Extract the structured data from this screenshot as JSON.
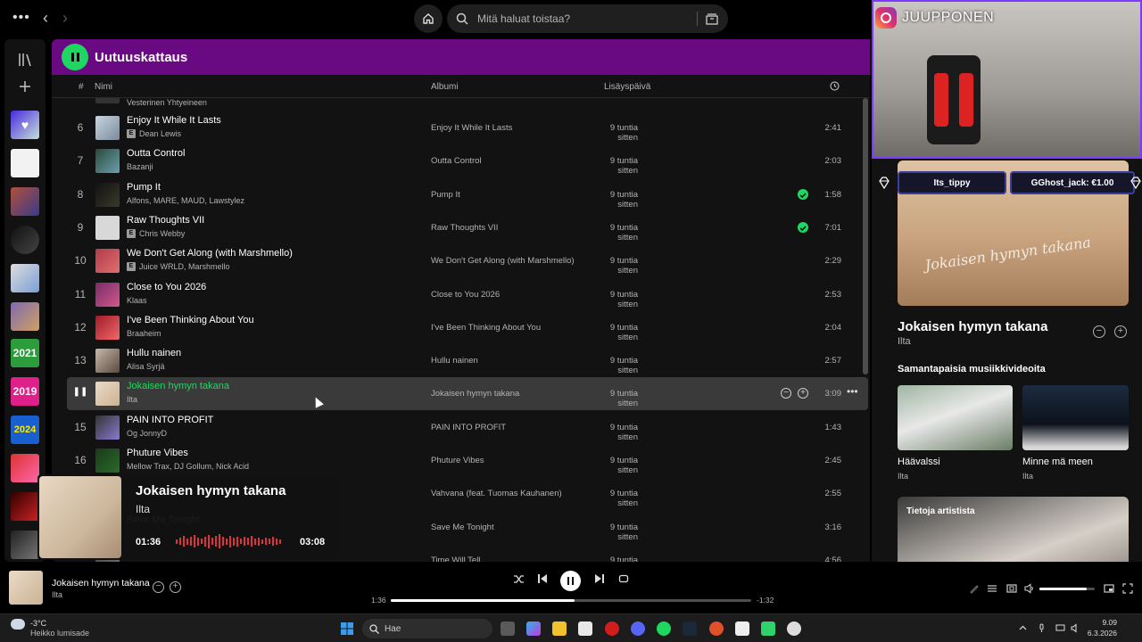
{
  "topbar": {
    "search_placeholder": "Mitä haluat toistaa?"
  },
  "playlist": {
    "title": "Uutuuskattaus",
    "columns": {
      "num": "#",
      "name": "Nimi",
      "album": "Albumi",
      "added": "Lisäyspäivä"
    },
    "partial_top_artist": "Vesterinen Yhtyeineen",
    "rows": [
      {
        "num": "6",
        "title": "Enjoy It While It Lasts",
        "artist": "Dean Lewis",
        "explicit": true,
        "album": "Enjoy It While It Lasts",
        "added": "9 tuntia sitten",
        "duration": "2:41",
        "liked": false,
        "active": false
      },
      {
        "num": "7",
        "title": "Outta Control",
        "artist": "Bazanji",
        "explicit": false,
        "album": "Outta Control",
        "added": "9 tuntia sitten",
        "duration": "2:03",
        "liked": false,
        "active": false
      },
      {
        "num": "8",
        "title": "Pump It",
        "artist": "Alfons, MARE, MAUD, Lawstylez",
        "explicit": false,
        "album": "Pump It",
        "added": "9 tuntia sitten",
        "duration": "1:58",
        "liked": true,
        "active": false
      },
      {
        "num": "9",
        "title": "Raw Thoughts VII",
        "artist": "Chris Webby",
        "explicit": true,
        "album": "Raw Thoughts VII",
        "added": "9 tuntia sitten",
        "duration": "7:01",
        "liked": true,
        "active": false
      },
      {
        "num": "10",
        "title": "We Don't Get Along (with Marshmello)",
        "artist": "Juice WRLD, Marshmello",
        "explicit": true,
        "album": "We Don't Get Along (with Marshmello)",
        "added": "9 tuntia sitten",
        "duration": "2:29",
        "liked": false,
        "active": false
      },
      {
        "num": "11",
        "title": "Close to You 2026",
        "artist": "Klaas",
        "explicit": false,
        "album": "Close to You 2026",
        "added": "9 tuntia sitten",
        "duration": "2:53",
        "liked": false,
        "active": false
      },
      {
        "num": "12",
        "title": "I've Been Thinking About You",
        "artist": "Braaheim",
        "explicit": false,
        "album": "I've Been Thinking About You",
        "added": "9 tuntia sitten",
        "duration": "2:04",
        "liked": false,
        "active": false
      },
      {
        "num": "13",
        "title": "Hullu nainen",
        "artist": "Alisa Syrjä",
        "explicit": false,
        "album": "Hullu nainen",
        "added": "9 tuntia sitten",
        "duration": "2:57",
        "liked": false,
        "active": false
      },
      {
        "num": "",
        "title": "Jokaisen hymyn takana",
        "artist": "Ilta",
        "explicit": false,
        "album": "Jokaisen hymyn takana",
        "added": "9 tuntia sitten",
        "duration": "3:09",
        "liked": false,
        "active": true
      },
      {
        "num": "15",
        "title": "PAIN INTO PROFIT",
        "artist": "Og JonnyD",
        "explicit": false,
        "album": "PAIN INTO PROFIT",
        "added": "9 tuntia sitten",
        "duration": "1:43",
        "liked": false,
        "active": false
      },
      {
        "num": "16",
        "title": "Phuture Vibes",
        "artist": "Mellow Trax, DJ Gollum, Nick Acid",
        "explicit": false,
        "album": "Phuture Vibes",
        "added": "9 tuntia sitten",
        "duration": "2:45",
        "liked": false,
        "active": false
      },
      {
        "num": "",
        "title": "",
        "artist": "",
        "explicit": false,
        "album": "Vahvana (feat. Tuomas Kauhanen)",
        "added": "9 tuntia sitten",
        "duration": "2:55",
        "liked": false,
        "active": false
      },
      {
        "num": "",
        "title": "Save Me Tonight",
        "artist": "",
        "explicit": false,
        "album": "Save Me Tonight",
        "added": "9 tuntia sitten",
        "duration": "3:16",
        "liked": false,
        "active": false
      },
      {
        "num": "",
        "title": "",
        "artist": "",
        "explicit": false,
        "album": "Time Will Tell",
        "added": "9 tuntia sitten",
        "duration": "4:56",
        "liked": false,
        "active": false
      }
    ]
  },
  "overlay_card": {
    "title": "Jokaisen hymyn takana",
    "artist": "Ilta",
    "elapsed": "01:36",
    "total": "03:08"
  },
  "stream": {
    "instagram": "JUUPPONEN",
    "tips": [
      "Its_tippy",
      "GGhost_jack: €1.00"
    ]
  },
  "now_playing_view": {
    "title": "Jokaisen hymyn takana",
    "artist": "Ilta",
    "art_script": "Jokaisen hymyn takana",
    "videos_heading": "Samantapaisia musiikkivideoita",
    "videos": [
      {
        "title": "Häävalssi",
        "artist": "Ilta"
      },
      {
        "title": "Minne mä meen",
        "artist": "Ilta"
      }
    ],
    "about_heading": "Tietoja artistista"
  },
  "player": {
    "title": "Jokaisen hymyn takana",
    "artist": "Ilta",
    "elapsed": "1:36",
    "remaining": "-1:32",
    "progress": 0.51,
    "volume": 0.85
  },
  "taskbar": {
    "temperature": "-3°C",
    "weather": "Heikko lumisade",
    "search_placeholder": "Hae",
    "time": "9.09",
    "date": "6.3.2026"
  },
  "colors": {
    "accent": "#1ed760",
    "header": "#6a0a82",
    "overlay_red": "#e0313e"
  }
}
